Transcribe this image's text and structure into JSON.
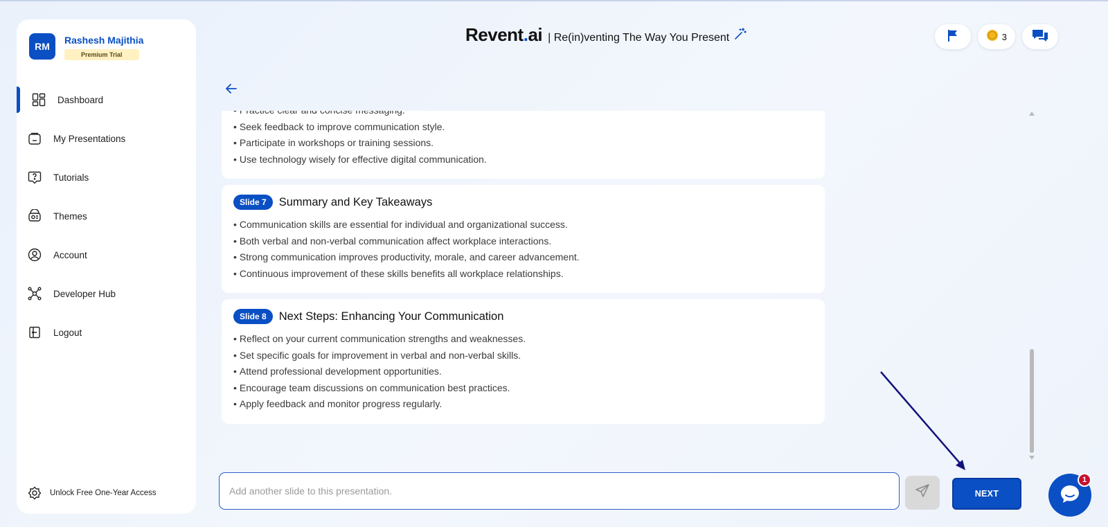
{
  "user": {
    "initials": "RM",
    "name": "Rashesh Majithia",
    "plan": "Premium Trial"
  },
  "nav": [
    {
      "label": "Dashboard",
      "icon": "dashboard-icon",
      "active": true
    },
    {
      "label": "My Presentations",
      "icon": "presentation-icon"
    },
    {
      "label": "Tutorials",
      "icon": "help-icon"
    },
    {
      "label": "Themes",
      "icon": "palette-icon"
    },
    {
      "label": "Account",
      "icon": "user-circle-icon"
    },
    {
      "label": "Developer Hub",
      "icon": "network-icon"
    },
    {
      "label": "Logout",
      "icon": "logout-icon"
    }
  ],
  "unlock_label": "Unlock Free One-Year Access",
  "header": {
    "brand_main": "Revent",
    "brand_dot": ".",
    "brand_suffix": "ai",
    "tagline": "| Re(in)venting The Way You Present"
  },
  "top_actions": {
    "coins": "3"
  },
  "slides": {
    "partial": {
      "bullets": [
        "Practice clear and concise messaging.",
        "Seek feedback to improve communication style.",
        "Participate in workshops or training sessions.",
        "Use technology wisely for effective digital communication."
      ]
    },
    "s7": {
      "badge": "Slide 7",
      "title": "Summary and Key Takeaways",
      "bullets": [
        "Communication skills are essential for individual and organizational success.",
        "Both verbal and non-verbal communication affect workplace interactions.",
        "Strong communication improves productivity, morale, and career advancement.",
        "Continuous improvement of these skills benefits all workplace relationships."
      ]
    },
    "s8": {
      "badge": "Slide 8",
      "title": "Next Steps: Enhancing Your Communication",
      "bullets": [
        "Reflect on your current communication strengths and weaknesses.",
        "Set specific goals for improvement in verbal and non-verbal skills.",
        "Attend professional development opportunities.",
        "Encourage team discussions on communication best practices.",
        "Apply feedback and monitor progress regularly."
      ]
    }
  },
  "input": {
    "placeholder": "Add another slide to this presentation.",
    "value": ""
  },
  "next_label": "NEXT",
  "chat_badge": "1",
  "colors": {
    "primary": "#0a4fc4",
    "badge_bg": "#fff1c2",
    "notify": "#c8102e",
    "annotation": "#12127a"
  }
}
